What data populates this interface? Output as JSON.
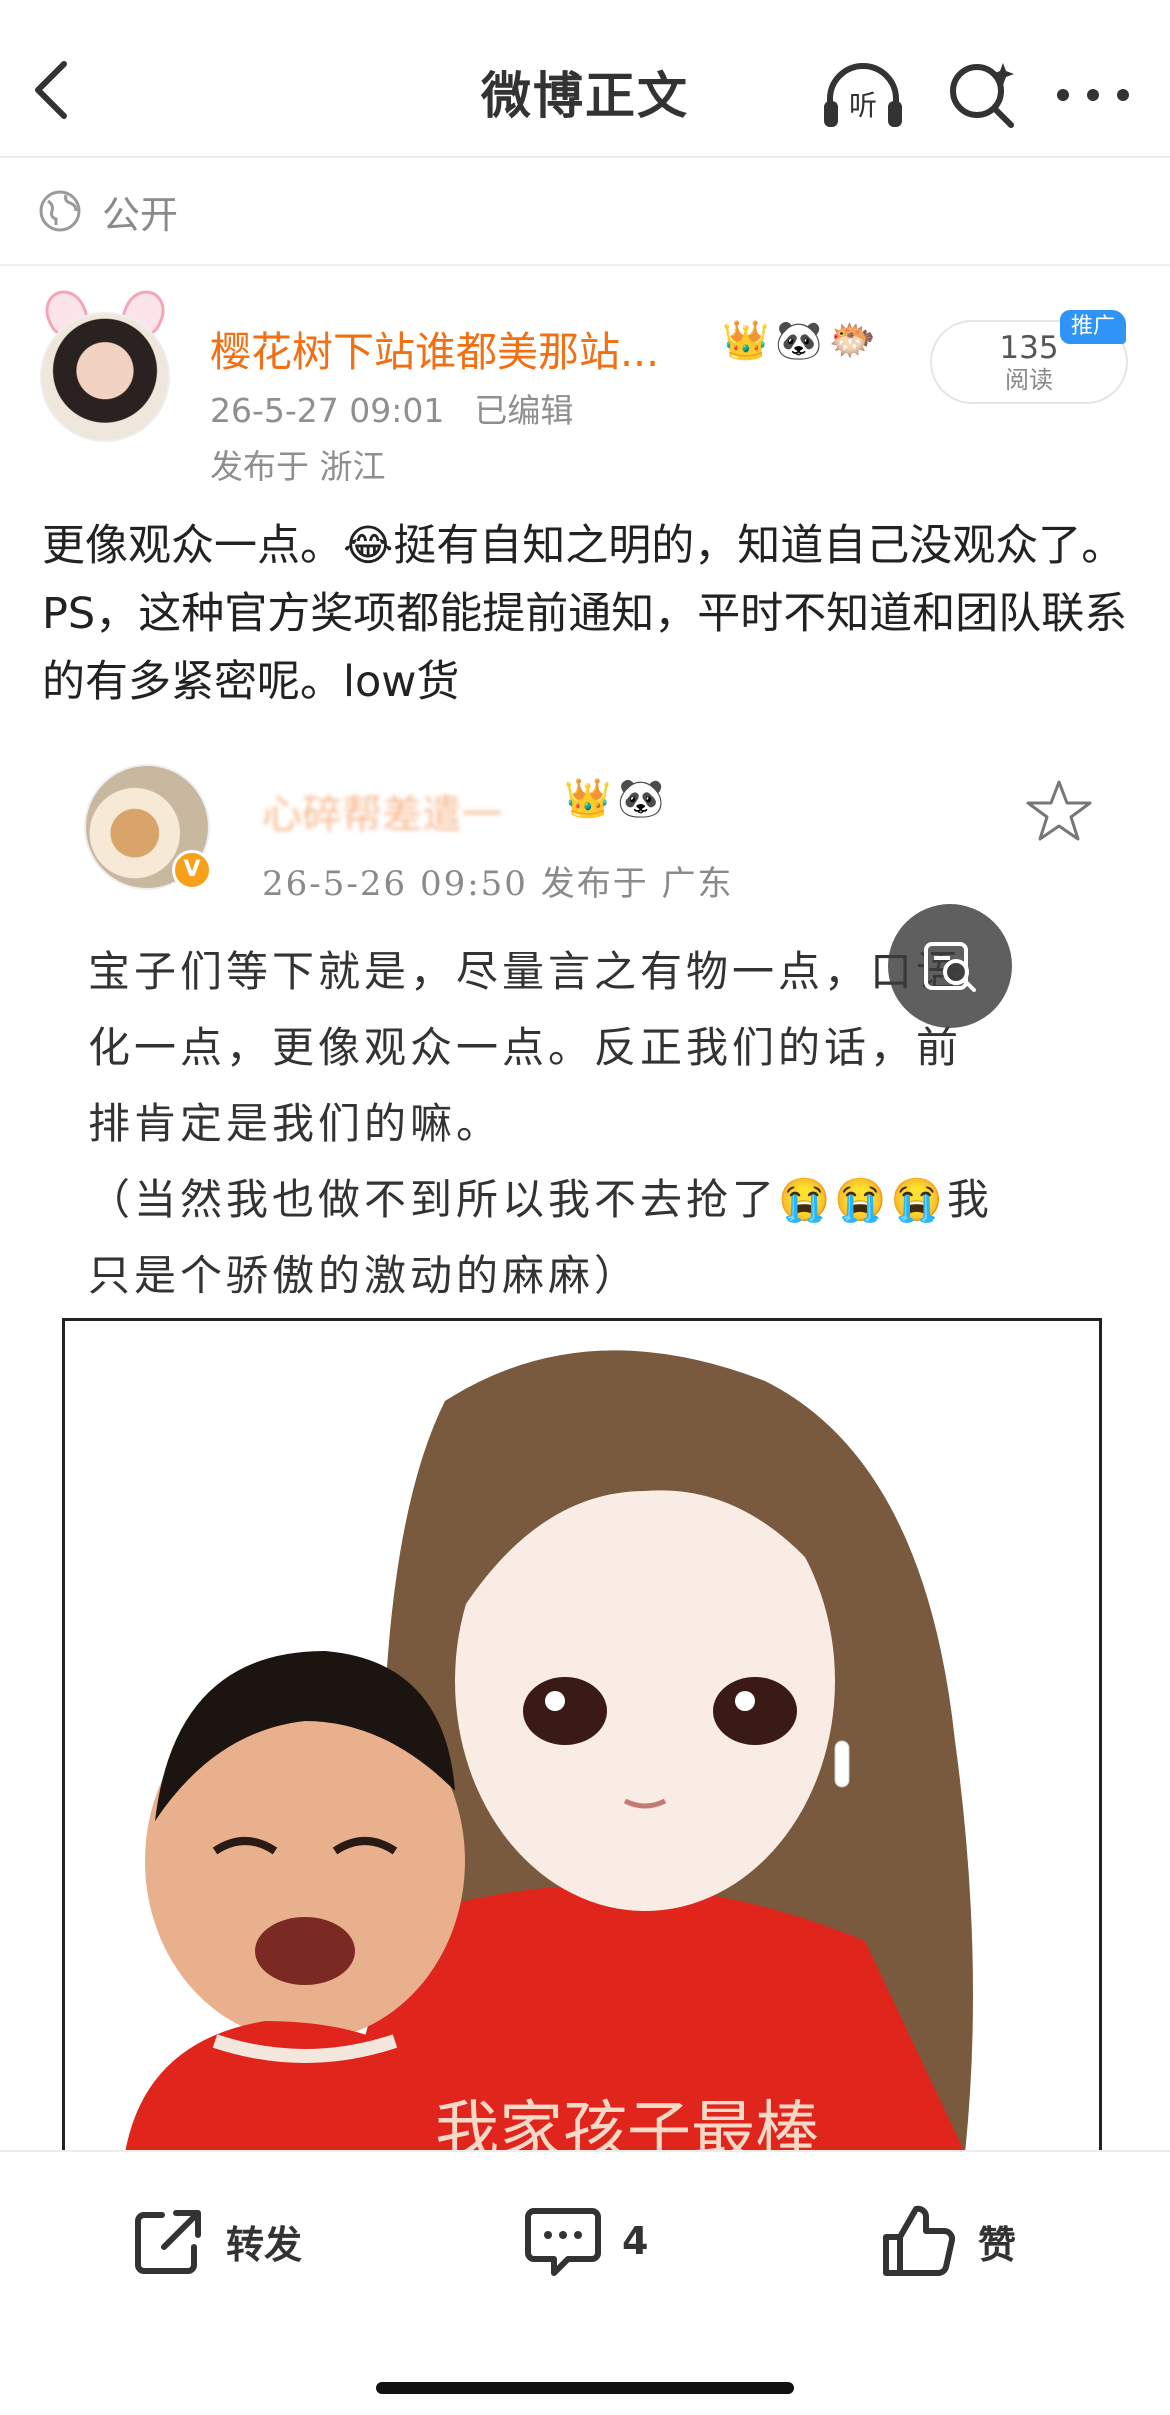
{
  "nav": {
    "title": "微博正文",
    "listen_label": "听"
  },
  "visibility": {
    "label": "公开"
  },
  "post": {
    "author": "樱花树下站谁都美那站...",
    "badges": [
      "👑",
      "🐼",
      "🐡"
    ],
    "date": "26-5-27 09:01",
    "edited": "已编辑",
    "location": "发布于 浙江",
    "reads_count": "135",
    "reads_label": "阅读",
    "promo_tag": "推广",
    "text_part1": "更像观众一点。",
    "text_emoji": "😂",
    "text_part2": "挺有自知之明的，知道自己没观众了。PS，这种官方奖项都能提前通知，平时不知道和团队联系的有多紧密呢。low货"
  },
  "embedded": {
    "author": "心碎帮差遣一",
    "badges": [
      "👑",
      "🐼"
    ],
    "meta": "26-5-26 09:50  发布于 广东",
    "text_line1": "宝子们等下就是，尽量言之有物一点，口语",
    "text_line2": "化一点，更像观众一点。反正我们的话，前",
    "text_line3": "排肯定是我们的嘛。",
    "text_line4": "（当然我也做不到所以我不去抢了😭😭😭我",
    "text_line5": "只是个骄傲的激动的麻麻）",
    "v_badge": "V",
    "pic_caption": "我家孩子最棒"
  },
  "toolbar": {
    "forward_label": "转发",
    "comment_count": "4",
    "like_label": "赞"
  },
  "colors": {
    "author_orange": "#f26f12",
    "promo_blue": "#2f94f5",
    "meta_gray": "#8f8f8f"
  }
}
